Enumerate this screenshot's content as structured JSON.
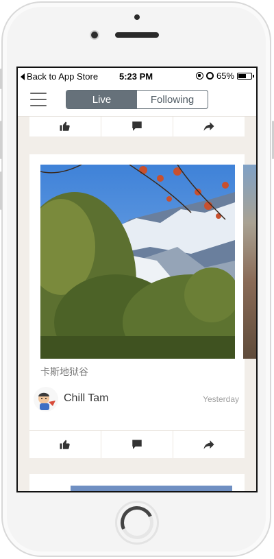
{
  "status_bar": {
    "back_label": "Back to App Store",
    "time": "5:23 PM",
    "battery_pct": "65%",
    "battery_level": 0.65
  },
  "nav": {
    "menu_icon": "hamburger-icon",
    "tabs": [
      {
        "label": "Live",
        "active": true
      },
      {
        "label": "Following",
        "active": false
      }
    ]
  },
  "feed": {
    "previous_card_actions": [
      "thumbs-up-icon",
      "comment-icon",
      "share-icon"
    ],
    "post": {
      "caption": "卡斯地狱谷",
      "author": "Chill Tam",
      "time": "Yesterday",
      "actions": [
        "thumbs-up-icon",
        "comment-icon",
        "share-icon"
      ]
    }
  },
  "colors": {
    "segment_active": "#66717a",
    "feed_background": "#f2eee9"
  }
}
